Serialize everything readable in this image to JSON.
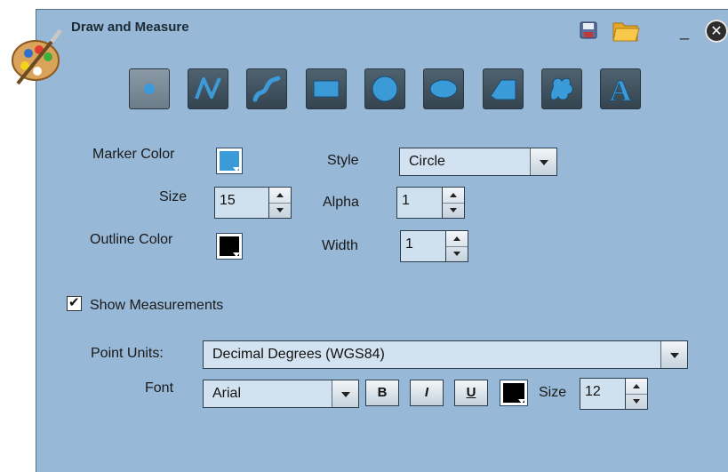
{
  "window": {
    "title": "Draw and Measure"
  },
  "header_icons": [
    "palette-icon",
    "save-icon",
    "folder-icon",
    "minimize-icon",
    "close-icon"
  ],
  "minimize_label": "_",
  "close_label": "✕",
  "tools": [
    {
      "name": "point-tool",
      "active": true
    },
    {
      "name": "polyline-tool"
    },
    {
      "name": "freehand-line-tool"
    },
    {
      "name": "rectangle-tool"
    },
    {
      "name": "circle-tool"
    },
    {
      "name": "ellipse-tool"
    },
    {
      "name": "polygon-tool"
    },
    {
      "name": "freehand-polygon-tool"
    },
    {
      "name": "text-tool",
      "glyph": "A"
    }
  ],
  "form": {
    "marker_color_label": "Marker Color",
    "marker_color": "#3b9ad8",
    "size_label": "Size",
    "size_value": "15",
    "outline_color_label": "Outline Color",
    "outline_color": "#000000",
    "style_label": "Style",
    "style_value": "Circle",
    "alpha_label": "Alpha",
    "alpha_value": "1",
    "width_label": "Width",
    "width_value": "1"
  },
  "measurements": {
    "show_label": "Show Measurements",
    "checked": true,
    "point_units_label": "Point Units:",
    "point_units_value": "Decimal Degrees (WGS84)",
    "font_label": "Font",
    "font_value": "Arial",
    "bold_label": "B",
    "italic_label": "I",
    "underline_label": "U",
    "font_color": "#000000",
    "size_label": "Size",
    "size_value": "12"
  },
  "colors": {
    "panel_bg": "#97b8d6",
    "tool_bg": "#3f505c",
    "tool_icon": "#3b9ad8"
  }
}
